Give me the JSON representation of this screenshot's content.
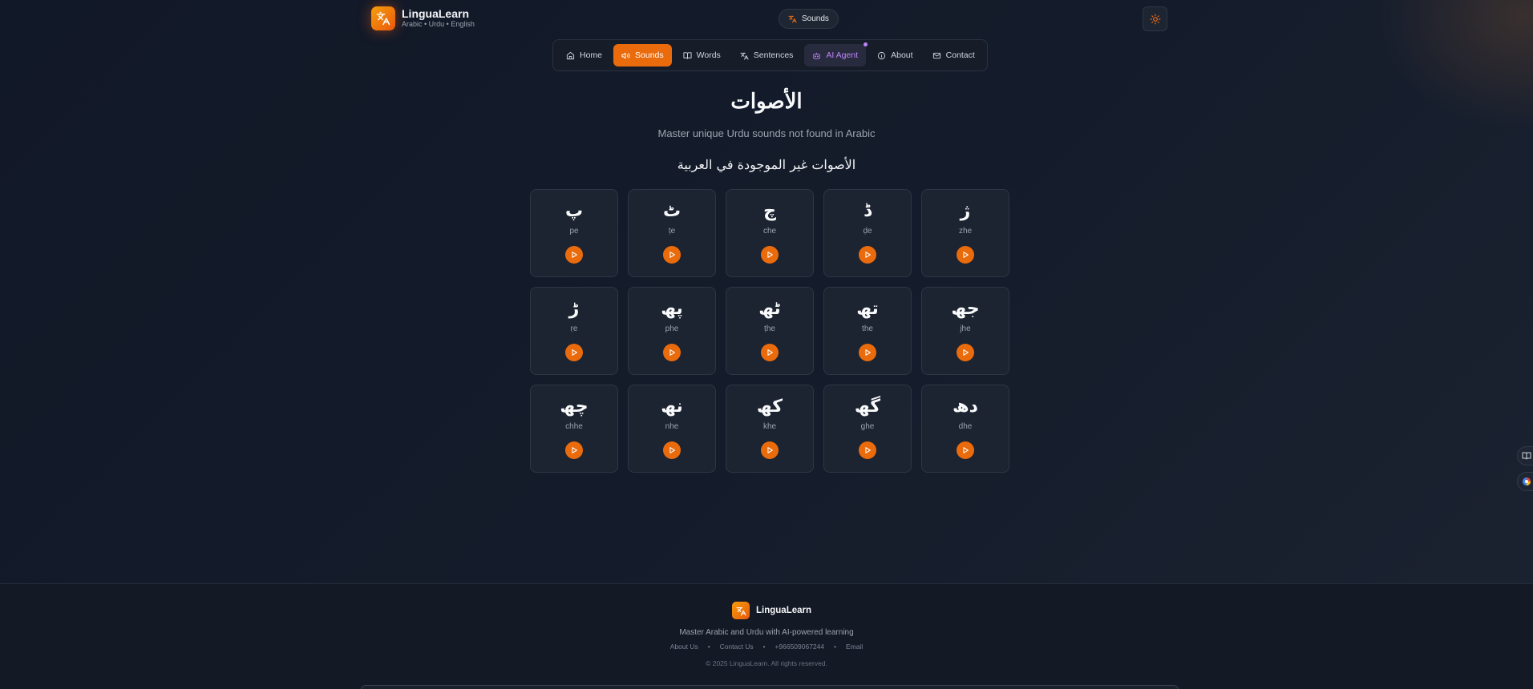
{
  "brand": {
    "name": "LinguaLearn",
    "sub": "Arabic • Urdu • English"
  },
  "header": {
    "sounds_pill": "Sounds"
  },
  "nav": [
    {
      "label": "Home",
      "icon": "home-icon"
    },
    {
      "label": "Sounds",
      "icon": "speaker-icon",
      "active": true
    },
    {
      "label": "Words",
      "icon": "book-icon"
    },
    {
      "label": "Sentences",
      "icon": "translate-icon"
    },
    {
      "label": "AI Agent",
      "icon": "robot-icon"
    },
    {
      "label": "About",
      "icon": "info-icon"
    },
    {
      "label": "Contact",
      "icon": "mail-icon"
    }
  ],
  "main": {
    "title": "الأصوات",
    "subtitle": "Master unique Urdu sounds not found in Arabic",
    "section_title": "الأصوات غير الموجودة في العربية"
  },
  "sounds": [
    {
      "letter": "پ",
      "translit": "pe"
    },
    {
      "letter": "ٹ",
      "translit": "ṭe"
    },
    {
      "letter": "چ",
      "translit": "che"
    },
    {
      "letter": "ڈ",
      "translit": "ḍe"
    },
    {
      "letter": "ژ",
      "translit": "zhe"
    },
    {
      "letter": "ڑ",
      "translit": "ṛe"
    },
    {
      "letter": "پھ",
      "translit": "phe"
    },
    {
      "letter": "ٹھ",
      "translit": "ṭhe"
    },
    {
      "letter": "تھ",
      "translit": "the"
    },
    {
      "letter": "جھ",
      "translit": "jhe"
    },
    {
      "letter": "چھ",
      "translit": "chhe"
    },
    {
      "letter": "نھ",
      "translit": "nhe"
    },
    {
      "letter": "کھ",
      "translit": "khe"
    },
    {
      "letter": "گھ",
      "translit": "ghe"
    },
    {
      "letter": "دھ",
      "translit": "dhe"
    }
  ],
  "footer": {
    "name": "LinguaLearn",
    "tagline": "Master Arabic and Urdu with AI-powered learning",
    "links": [
      "About Us",
      "Contact Us",
      "+966509067244",
      "Email"
    ],
    "separator": "•",
    "copyright": "© 2025 LinguaLearn. All rights reserved."
  },
  "colors": {
    "accent": "#ea6b0c",
    "agent": "#c084fc",
    "background": "#131a27"
  }
}
